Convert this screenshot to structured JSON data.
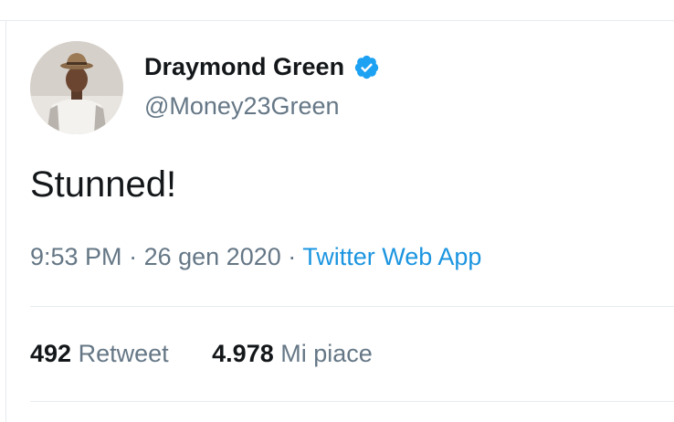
{
  "tweet": {
    "author": {
      "display_name": "Draymond Green",
      "handle": "@Money23Green",
      "verified": true,
      "avatar_icon": "profile-photo"
    },
    "text": "Stunned!",
    "time": "9:53 PM",
    "separator": "·",
    "date": "26 gen 2020",
    "source": "Twitter Web App",
    "stats": {
      "retweets_count": "492",
      "retweets_label": "Retweet",
      "likes_count": "4.978",
      "likes_label": "Mi piace"
    }
  },
  "colors": {
    "text_primary": "#14171a",
    "text_secondary": "#657786",
    "link": "#1b95e0",
    "verified_badge": "#1da1f2",
    "divider": "#e6ecf0"
  }
}
